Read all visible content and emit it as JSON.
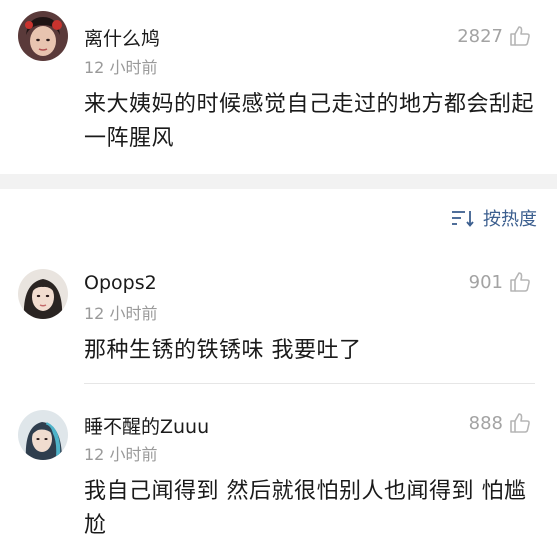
{
  "comments": [
    {
      "username": "离什么鸠",
      "time": "12 小时前",
      "likes": "2827",
      "text": "来大姨妈的时候感觉自己走过的地方都会刮起一阵腥风",
      "avatar": "avatar-photo"
    },
    {
      "username": "Opops2",
      "time": "12 小时前",
      "likes": "901",
      "text": "那种生锈的铁锈味 我要吐了",
      "avatar": "avatar-photo"
    },
    {
      "username": "睡不醒的Zuuu",
      "time": "12 小时前",
      "likes": "888",
      "text": "我自己闻得到 然后就很怕别人也闻得到 怕尴尬",
      "avatar": "avatar-photo"
    }
  ],
  "sort": {
    "label": "按热度",
    "icon": "sort-icon"
  },
  "icons": {
    "like": "thumbs-up-icon"
  },
  "colors": {
    "accent": "#3c5f8f",
    "muted": "#9a9a9a",
    "separator": "#f2f2f2"
  }
}
